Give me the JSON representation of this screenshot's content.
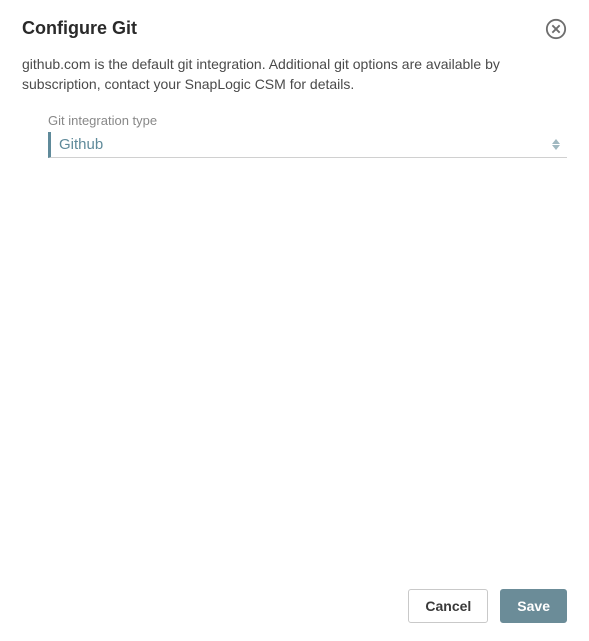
{
  "dialog": {
    "title": "Configure Git",
    "description": "github.com is the default git integration. Additional git options are available by subscription, contact your SnapLogic CSM for details."
  },
  "form": {
    "integration_type_label": "Git integration type",
    "integration_type_value": "Github"
  },
  "footer": {
    "cancel_label": "Cancel",
    "save_label": "Save"
  }
}
